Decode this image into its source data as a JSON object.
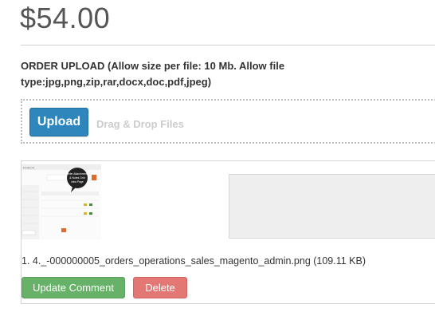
{
  "product": {
    "price": "$54.00"
  },
  "order_upload": {
    "label": "ORDER UPLOAD (Allow size per file: 10 Mb. Allow file type:jpg,png,zip,rar,docx,doc,pdf,jpeg)",
    "upload_button": "Upload",
    "drag_drop_text": "Drag & Drop Files"
  },
  "uploaded_file": {
    "thumbnail_icon": "screenshot-thumbnail",
    "thumbnail_callout": "Order Attachments & Notes Grid view Page",
    "name": "1. 4._-000000005_orders_operations_sales_magento_admin.png (109.11 KB)",
    "update_comment_button": "Update Comment",
    "delete_button": "Delete"
  },
  "colors": {
    "upload_button": "#2e86bd",
    "update_button": "#67b168",
    "delete_button": "#e37774",
    "price_text": "#555555"
  }
}
